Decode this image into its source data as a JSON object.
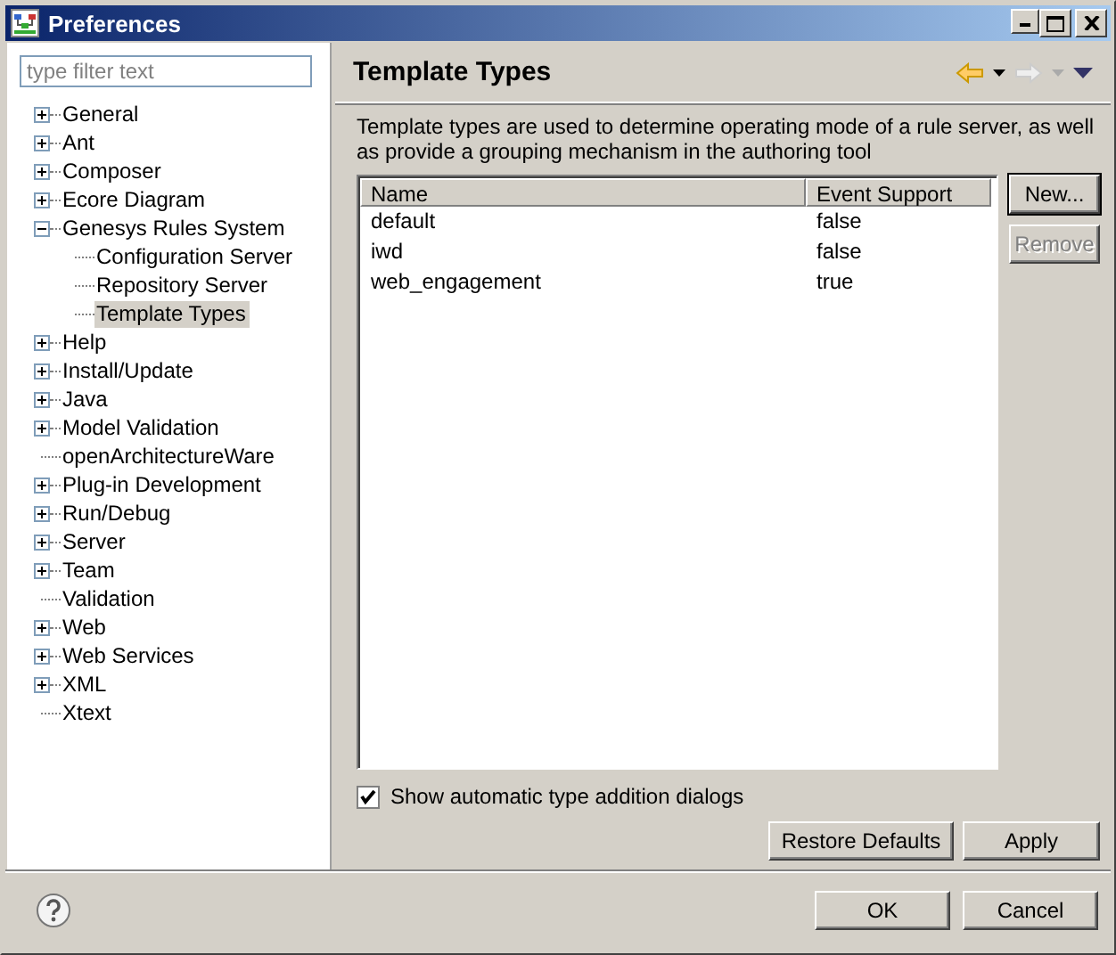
{
  "window": {
    "title": "Preferences"
  },
  "filter": {
    "placeholder": "type filter text"
  },
  "tree": [
    {
      "label": "General",
      "kind": "node",
      "expanded": false,
      "selected": false
    },
    {
      "label": "Ant",
      "kind": "node",
      "expanded": false,
      "selected": false
    },
    {
      "label": "Composer",
      "kind": "node",
      "expanded": false,
      "selected": false
    },
    {
      "label": "Ecore Diagram",
      "kind": "node",
      "expanded": false,
      "selected": false
    },
    {
      "label": "Genesys Rules System",
      "kind": "node",
      "expanded": true,
      "selected": false,
      "children": [
        {
          "label": "Configuration Server",
          "kind": "leaf",
          "selected": false
        },
        {
          "label": "Repository Server",
          "kind": "leaf",
          "selected": false
        },
        {
          "label": "Template Types",
          "kind": "leaf",
          "selected": true
        }
      ]
    },
    {
      "label": "Help",
      "kind": "node",
      "expanded": false,
      "selected": false
    },
    {
      "label": "Install/Update",
      "kind": "node",
      "expanded": false,
      "selected": false
    },
    {
      "label": "Java",
      "kind": "node",
      "expanded": false,
      "selected": false
    },
    {
      "label": "Model Validation",
      "kind": "node",
      "expanded": false,
      "selected": false
    },
    {
      "label": "openArchitectureWare",
      "kind": "leaf",
      "selected": false
    },
    {
      "label": "Plug-in Development",
      "kind": "node",
      "expanded": false,
      "selected": false
    },
    {
      "label": "Run/Debug",
      "kind": "node",
      "expanded": false,
      "selected": false
    },
    {
      "label": "Server",
      "kind": "node",
      "expanded": false,
      "selected": false
    },
    {
      "label": "Team",
      "kind": "node",
      "expanded": false,
      "selected": false
    },
    {
      "label": "Validation",
      "kind": "leaf",
      "selected": false
    },
    {
      "label": "Web",
      "kind": "node",
      "expanded": false,
      "selected": false
    },
    {
      "label": "Web Services",
      "kind": "node",
      "expanded": false,
      "selected": false
    },
    {
      "label": "XML",
      "kind": "node",
      "expanded": false,
      "selected": false
    },
    {
      "label": "Xtext",
      "kind": "leaf",
      "selected": false
    }
  ],
  "page": {
    "title": "Template Types",
    "description": "Template types are used to determine operating mode of a rule server, as well as provide a grouping mechanism in the authoring tool"
  },
  "table": {
    "columns": [
      "Name",
      "Event Support"
    ],
    "rows": [
      [
        "default",
        "false"
      ],
      [
        "iwd",
        "false"
      ],
      [
        "web_engagement",
        "true"
      ]
    ]
  },
  "side_buttons": [
    {
      "label": "New...",
      "disabled": false,
      "focused": true
    },
    {
      "label": "Remove",
      "disabled": true,
      "focused": false
    }
  ],
  "option": {
    "label": "Show automatic type addition dialogs",
    "checked": true
  },
  "page_buttons": [
    "Restore Defaults",
    "Apply"
  ],
  "dialog_buttons": [
    "OK",
    "Cancel"
  ]
}
